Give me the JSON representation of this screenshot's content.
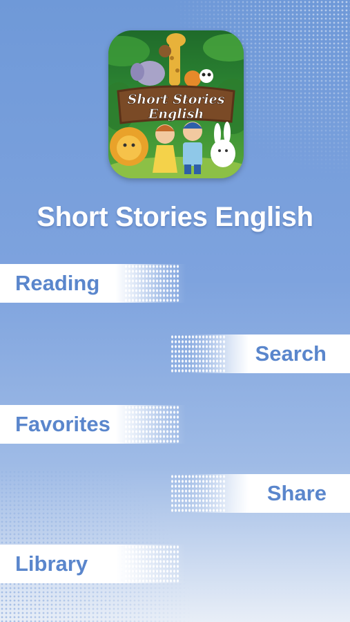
{
  "app": {
    "title": "Short Stories English",
    "logo": {
      "line1": "Short Stories",
      "line2": "English",
      "description_icon": "storybook-animals-icon"
    }
  },
  "menu": {
    "reading": "Reading",
    "search": "Search",
    "favorites": "Favorites",
    "share": "Share",
    "library": "Library"
  },
  "colors": {
    "background_top": "#6f99d8",
    "background_bottom": "#e8eef7",
    "menu_text": "#5a86cc",
    "title_text": "#ffffff"
  }
}
